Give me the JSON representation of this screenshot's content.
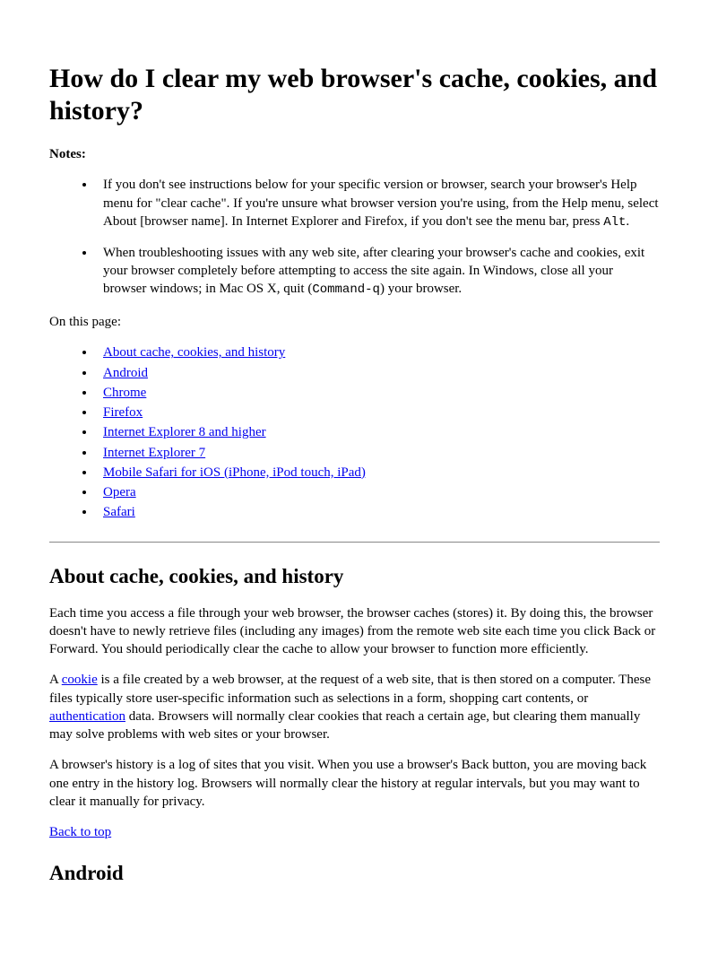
{
  "title": "How do I clear my web browser's cache, cookies, and history?",
  "notesLabel": "Notes:",
  "notes": {
    "item1_pre": "If you don't see instructions below for your specific version or browser, search your browser's Help menu for \"clear cache\". If you're unsure what browser version you're using, from the Help menu, select About [browser name]. In Internet Explorer and Firefox, if you don't see the menu bar, press ",
    "item1_code": "Alt",
    "item1_post": ".",
    "item2_pre": "When troubleshooting issues with any web site, after clearing your browser's cache and cookies, exit your browser completely before attempting to access the site again. In Windows, close all your browser windows; in Mac OS X, quit (",
    "item2_code": "Command-q",
    "item2_post": ") your browser."
  },
  "onThisPage": "On this page:",
  "toc": {
    "about": "About cache, cookies, and history",
    "android": "Android",
    "chrome": "Chrome",
    "firefox": "Firefox",
    "ie8": "Internet Explorer 8 and higher",
    "ie7": "Internet Explorer 7",
    "mobileSafari": "Mobile Safari for iOS (iPhone, iPod touch, iPad)",
    "opera": "Opera",
    "safari": "Safari"
  },
  "sections": {
    "about": {
      "heading": "About cache, cookies, and history",
      "p1": "Each time you access a file through your web browser, the browser caches (stores) it. By doing this, the browser doesn't have to newly retrieve files (including any images) from the remote web site each time you click Back or Forward. You should periodically clear the cache to allow your browser to function more efficiently.",
      "p2_pre": "A ",
      "p2_link1": "cookie",
      "p2_mid": " is a file created by a web browser, at the request of a web site, that is then stored on a computer. These files typically store user-specific information such as selections in a form, shopping cart contents, or ",
      "p2_link2": "authentication",
      "p2_post": " data. Browsers will normally clear cookies that reach a certain age, but clearing them manually may solve problems with web sites or your browser.",
      "p3": "A browser's history is a log of sites that you visit. When you use a browser's Back button, you are moving back one entry in the history log. Browsers will normally clear the history at regular intervals, but you may want to clear it manually for privacy."
    },
    "backToTop": "Back to top",
    "androidHeading": "Android"
  }
}
